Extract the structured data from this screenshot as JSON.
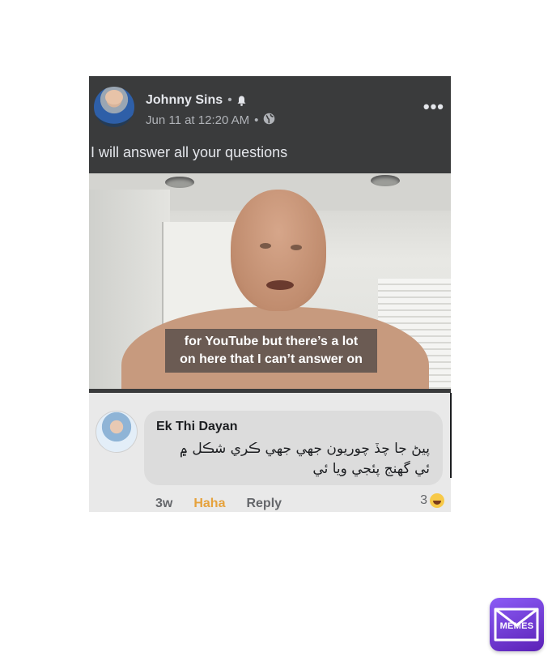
{
  "post": {
    "author": "Johnny Sins",
    "dot": "•",
    "date": "Jun 11 at 12:20 AM",
    "more": "•••",
    "text": "I will answer all your questions",
    "video_caption_line1": "for YouTube but there’s a lot",
    "video_caption_line2": "on here that I can’t answer on"
  },
  "comment": {
    "name": "Ek Thi Dayan",
    "line1": "پيڻ جا چڏ چوريون جهي جهي ڪري شڪل ۾",
    "line2": "ئي گهنج پئجي ويا ئي",
    "age": "3w",
    "haha": "Haha",
    "reply": "Reply",
    "reaction_count": "3"
  },
  "watermark": {
    "label": "MEMES"
  },
  "icons": [
    "bell-icon",
    "globe-icon",
    "more-options-icon",
    "haha-reaction-icon",
    "memes-logo-icon"
  ],
  "colors": {
    "post_bg": "#3a3b3c",
    "comment_bg": "#e9e9e9",
    "haha_accent": "#e6a23c",
    "logo_purple": "#7c3aed"
  }
}
